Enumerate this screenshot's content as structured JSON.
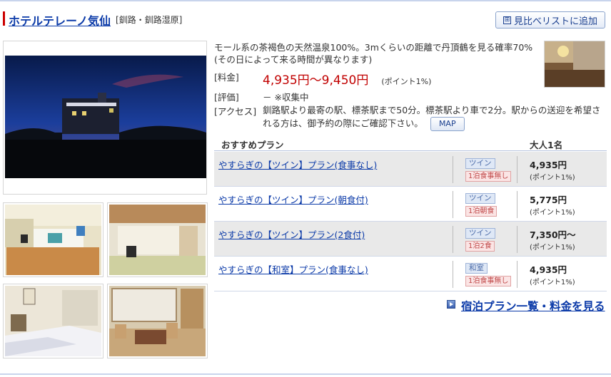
{
  "header": {
    "hotel_name": "ホテルテレーノ気仙",
    "area": "[釧路・釧路湿原]",
    "compare_button": "見比べリストに追加",
    "compare_icon": "⊞"
  },
  "description": "モール系の茶褐色の天然温泉100%。3mくらいの距離で丹頂鶴を見る確率70%(その日によって来る時間が異なります)",
  "info": {
    "price_label": "[料金]",
    "price_value": "4,935円〜9,450円",
    "price_point": "(ポイント1%)",
    "rating_label": "[評価]",
    "rating_value": "－ ※収集中",
    "access_label": "[アクセス]",
    "access_value": "釧路駅より最寄の駅、標茶駅まで50分。標茶駅より車で2分。駅からの送迎を希望される方は、御予約の際にご確認下さい。",
    "map_button": "MAP"
  },
  "plans_header": {
    "plan_col": "おすすめプラン",
    "price_col": "大人1名"
  },
  "plans": [
    {
      "name": "やすらぎの【ツイン】プラン(食事なし)",
      "room": "ツイン",
      "meal": "1泊食事無し",
      "price": "4,935円",
      "point": "(ポイント1%)"
    },
    {
      "name": "やすらぎの【ツイン】プラン(朝食付)",
      "room": "ツイン",
      "meal": "1泊朝食",
      "price": "5,775円",
      "point": "(ポイント1%)"
    },
    {
      "name": "やすらぎの【ツイン】プラン(2食付)",
      "room": "ツイン",
      "meal": "1泊2食",
      "price": "7,350円〜",
      "point": "(ポイント1%)"
    },
    {
      "name": "やすらぎの【和室】プラン(食事なし)",
      "room": "和室",
      "meal": "1泊食事無し",
      "price": "4,935円",
      "point": "(ポイント1%)"
    }
  ],
  "more_link": "宿泊プラン一覧・料金を見る",
  "colors": {
    "link": "#0b3aa8",
    "price": "#c10000",
    "accent_bar": "#cc0000"
  }
}
